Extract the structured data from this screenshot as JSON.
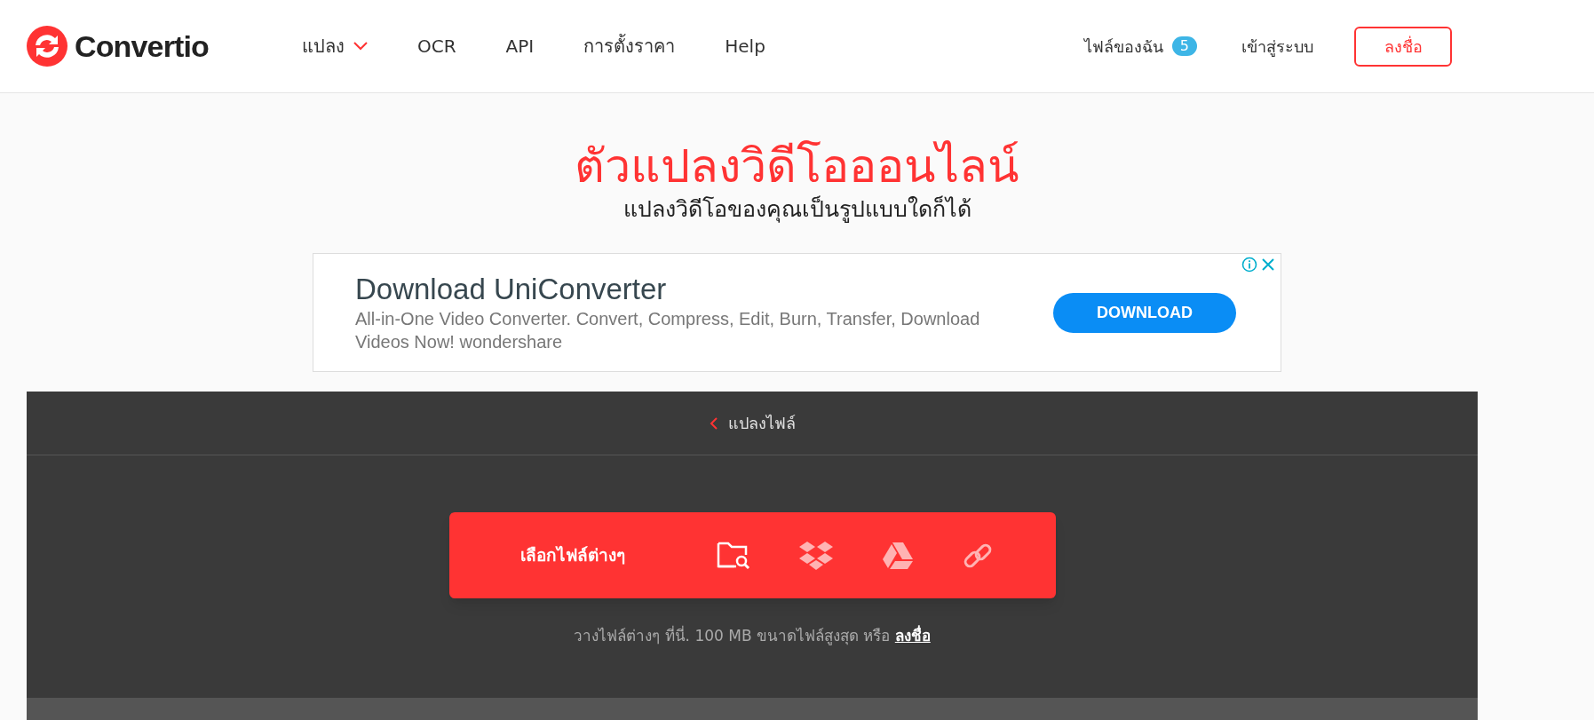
{
  "header": {
    "logo": "Convertio",
    "nav": [
      {
        "label": "แปลง",
        "dropdown": true
      },
      {
        "label": "OCR",
        "dropdown": false
      },
      {
        "label": "API",
        "dropdown": false
      },
      {
        "label": "การตั้งราคา",
        "dropdown": false
      },
      {
        "label": "Help",
        "dropdown": false
      }
    ],
    "my_files": {
      "label": "ไฟล์ของฉัน",
      "count": "5"
    },
    "login": "เข้าสู่ระบบ",
    "signup": "ลงชื่อ"
  },
  "hero": {
    "title": "ตัวแปลงวิดีโอออนไลน์",
    "subtitle": "แปลงวิดีโอของคุณเป็นรูปแบบใดก็ได้"
  },
  "ad": {
    "title": "Download UniConverter",
    "text": "All-in-One Video Converter. Convert, Compress, Edit, Burn, Transfer, Download Videos Now! wondershare",
    "button": "DOWNLOAD"
  },
  "converter": {
    "back": "แปลงไฟล์",
    "choose": "เลือกไฟล์ต่างๆ",
    "hint": "วางไฟล์ต่างๆ ที่นี่. 100 MB ขนาดไฟล์สูงสุด หรือ",
    "hint_link": "ลงชื่อ"
  }
}
